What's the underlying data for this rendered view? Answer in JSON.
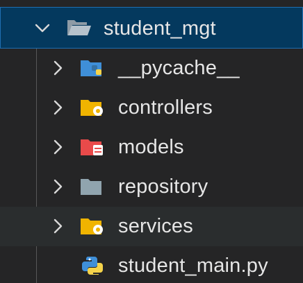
{
  "explorer": {
    "root": {
      "label": "student_mgt",
      "expanded": true,
      "icon": "folder-open-icon"
    },
    "items": [
      {
        "label": "__pycache__",
        "type": "folder",
        "icon": "python-folder-icon",
        "color": "#3f8fd8",
        "expanded": false
      },
      {
        "label": "controllers",
        "type": "folder",
        "icon": "controllers-folder-icon",
        "color": "#f0b400",
        "expanded": false
      },
      {
        "label": "models",
        "type": "folder",
        "icon": "models-folder-icon",
        "color": "#e94a4a",
        "expanded": false
      },
      {
        "label": "repository",
        "type": "folder",
        "icon": "folder-icon",
        "color": "#90a4ae",
        "expanded": false
      },
      {
        "label": "services",
        "type": "folder",
        "icon": "services-folder-icon",
        "color": "#f0b400",
        "expanded": false
      },
      {
        "label": "student_main.py",
        "type": "file",
        "icon": "python-file-icon",
        "expanded": false
      }
    ],
    "colors": {
      "background": "#252526",
      "selection": "#04395e",
      "selection_border": "#1f6fb2",
      "text": "#e6e6e6"
    }
  }
}
